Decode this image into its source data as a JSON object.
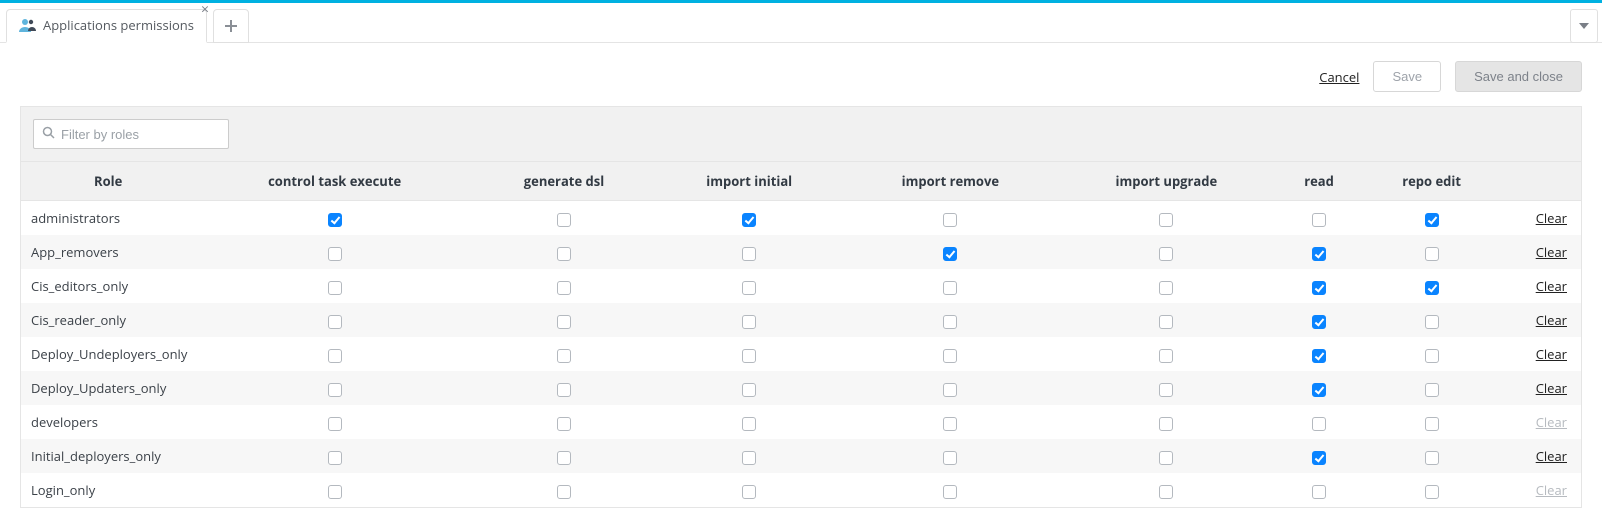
{
  "tab": {
    "title": "Applications permissions"
  },
  "actions": {
    "cancel": "Cancel",
    "save": "Save",
    "save_close": "Save and close"
  },
  "search": {
    "placeholder": "Filter by roles"
  },
  "columns": {
    "role": "Role",
    "perms": [
      "control task execute",
      "generate dsl",
      "import initial",
      "import remove",
      "import upgrade",
      "read",
      "repo edit"
    ]
  },
  "clear_label": "Clear",
  "rows": [
    {
      "role": "administrators",
      "checks": [
        true,
        false,
        true,
        false,
        false,
        false,
        true
      ],
      "clear_enabled": true
    },
    {
      "role": "App_removers",
      "checks": [
        false,
        false,
        false,
        true,
        false,
        true,
        false
      ],
      "clear_enabled": true
    },
    {
      "role": "Cis_editors_only",
      "checks": [
        false,
        false,
        false,
        false,
        false,
        true,
        true
      ],
      "clear_enabled": true
    },
    {
      "role": "Cis_reader_only",
      "checks": [
        false,
        false,
        false,
        false,
        false,
        true,
        false
      ],
      "clear_enabled": true
    },
    {
      "role": "Deploy_Undeployers_only",
      "checks": [
        false,
        false,
        false,
        false,
        false,
        true,
        false
      ],
      "clear_enabled": true
    },
    {
      "role": "Deploy_Updaters_only",
      "checks": [
        false,
        false,
        false,
        false,
        false,
        true,
        false
      ],
      "clear_enabled": true
    },
    {
      "role": "developers",
      "checks": [
        false,
        false,
        false,
        false,
        false,
        false,
        false
      ],
      "clear_enabled": false
    },
    {
      "role": "Initial_deployers_only",
      "checks": [
        false,
        false,
        false,
        false,
        false,
        true,
        false
      ],
      "clear_enabled": true
    },
    {
      "role": "Login_only",
      "checks": [
        false,
        false,
        false,
        false,
        false,
        false,
        false
      ],
      "clear_enabled": false
    }
  ]
}
